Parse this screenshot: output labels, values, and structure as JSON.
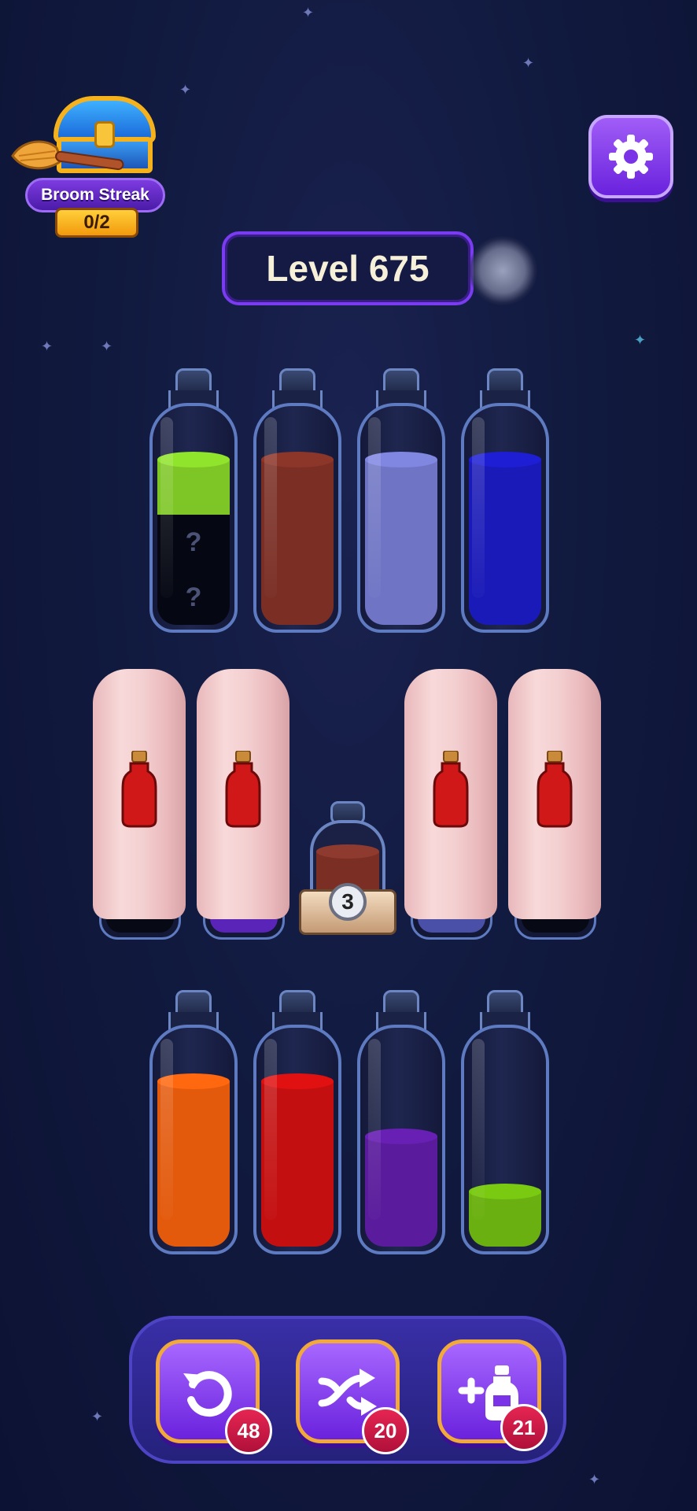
{
  "streak": {
    "title": "Broom Streak",
    "count": "0/2"
  },
  "level": {
    "label": "Level 675"
  },
  "top_bottles": [
    {
      "layers": [
        {
          "color": "#7ec626",
          "hidden": false
        },
        {
          "color": "#050712",
          "hidden": true
        },
        {
          "color": "#050712",
          "hidden": true
        }
      ]
    },
    {
      "layers": [
        {
          "color": "#7a2e24"
        },
        {
          "color": "#7a2e24"
        },
        {
          "color": "#7a2e24"
        }
      ]
    },
    {
      "layers": [
        {
          "color": "#6f75c4"
        },
        {
          "color": "#6f75c4"
        },
        {
          "color": "#6f75c4"
        }
      ]
    },
    {
      "layers": [
        {
          "color": "#1a1ab8"
        },
        {
          "color": "#1a1ab8"
        },
        {
          "color": "#1a1ab8"
        }
      ]
    }
  ],
  "bottom_bottles": [
    {
      "color": "#e35a0d",
      "fill": 0.75
    },
    {
      "color": "#c40f10",
      "fill": 0.75
    },
    {
      "color": "#5a1b9c",
      "fill": 0.5
    },
    {
      "color": "#6ab010",
      "fill": 0.25
    }
  ],
  "mystery_bottle": {
    "count": "3",
    "color": "#7a2e24"
  },
  "actions": {
    "undo": {
      "count": "48",
      "icon": "undo-icon"
    },
    "shuffle": {
      "count": "20",
      "icon": "shuffle-icon"
    },
    "add_bottle": {
      "count": "21",
      "icon": "add-bottle-icon"
    }
  },
  "colors": {
    "accent": "#7a3cf0",
    "tray": "#2e2893",
    "badge": "#c4143f"
  }
}
